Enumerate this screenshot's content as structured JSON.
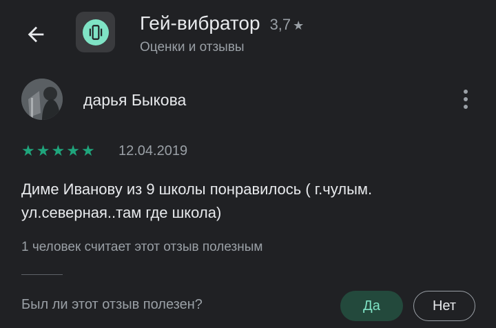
{
  "header": {
    "app_name": "Гей-вибратор",
    "rating": "3,7",
    "rating_star": "★",
    "subtitle": "Оценки и отзывы",
    "back_icon": "arrow-left-icon",
    "app_icon": "vibration-icon"
  },
  "review": {
    "author": "дарья Быкова",
    "stars": [
      "★",
      "★",
      "★",
      "★",
      "★"
    ],
    "date": "12.04.2019",
    "text": "Диме Иванову из 9 школы понравилось ( г.чулым. ул.северная..там где школа)",
    "helpful_count_text": "1 человек считает этот отзыв полезным"
  },
  "feedback": {
    "question": "Был ли этот отзыв полезен?",
    "yes_label": "Да",
    "no_label": "Нет"
  },
  "colors": {
    "background": "#202124",
    "star_green": "#1fa57c",
    "accent": "#7fe3c5"
  }
}
